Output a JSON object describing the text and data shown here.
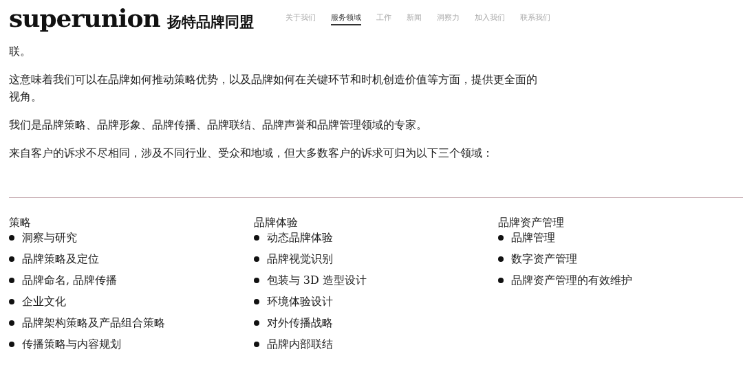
{
  "header": {
    "logo": "superunion",
    "brand_cn": "扬特品牌同盟",
    "nav": [
      {
        "label": "关于我们",
        "selected": false
      },
      {
        "label": "服务领域",
        "selected": true
      },
      {
        "label": "工作",
        "selected": false
      },
      {
        "label": "新闻",
        "selected": false
      },
      {
        "label": "洞察力",
        "selected": false
      },
      {
        "label": "加入我们",
        "selected": false
      },
      {
        "label": "联系我们",
        "selected": false
      }
    ]
  },
  "paragraphs": [
    "联。",
    "这意味着我们可以在品牌如何推动策略优势，以及品牌如何在关键环节和时机创造价值等方面，提供更全面的视角。",
    "我们是品牌策略、品牌形象、品牌传播、品牌联结、品牌声誉和品牌管理领域的专家。",
    "来自客户的诉求不尽相同，涉及不同行业、受众和地域，但大多数客户的诉求可归为以下三个领域："
  ],
  "columns": [
    {
      "title": "策略",
      "items": [
        "洞察与研究",
        "品牌策略及定位",
        "品牌命名, 品牌传播",
        "企业文化",
        "品牌架构策略及产品组合策略",
        "传播策略与内容规划"
      ]
    },
    {
      "title": "品牌体验",
      "items": [
        "动态品牌体验",
        "品牌视觉识别",
        "包装与 3D 造型设计",
        "环境体验设计",
        "对外传播战略",
        "品牌内部联结"
      ]
    },
    {
      "title": "品牌资产管理",
      "items": [
        "品牌管理",
        "数字资产管理",
        "品牌资产管理的有效维护"
      ]
    }
  ]
}
